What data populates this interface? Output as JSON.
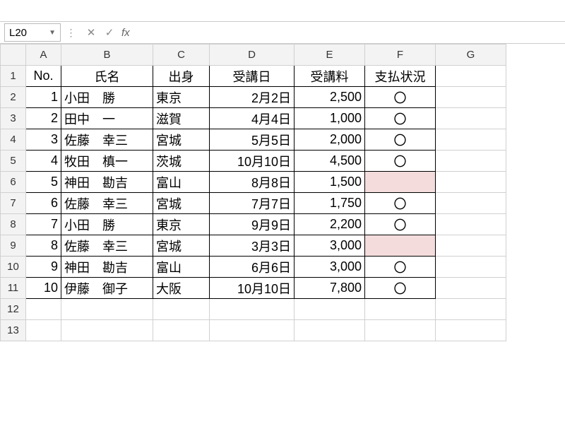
{
  "namebox": "L20",
  "fx_label": "fx",
  "formula_value": "",
  "columns": [
    "A",
    "B",
    "C",
    "D",
    "E",
    "F",
    "G"
  ],
  "rownums": [
    "1",
    "2",
    "3",
    "4",
    "5",
    "6",
    "7",
    "8",
    "9",
    "10",
    "11",
    "12",
    "13"
  ],
  "headers": {
    "A": "No.",
    "B": "氏名",
    "C": "出身",
    "D": "受講日",
    "E": "受講料",
    "F": "支払状況"
  },
  "rows": [
    {
      "no": "1",
      "name": "小田　勝",
      "origin": "東京",
      "date": "2月2日",
      "fee": "2,500",
      "status": "〇",
      "pink": false
    },
    {
      "no": "2",
      "name": "田中　一",
      "origin": "滋賀",
      "date": "4月4日",
      "fee": "1,000",
      "status": "〇",
      "pink": false
    },
    {
      "no": "3",
      "name": "佐藤　幸三",
      "origin": "宮城",
      "date": "5月5日",
      "fee": "2,000",
      "status": "〇",
      "pink": false
    },
    {
      "no": "4",
      "name": "牧田　槙一",
      "origin": "茨城",
      "date": "10月10日",
      "fee": "4,500",
      "status": "〇",
      "pink": false
    },
    {
      "no": "5",
      "name": "神田　勘吉",
      "origin": "富山",
      "date": "8月8日",
      "fee": "1,500",
      "status": "",
      "pink": true
    },
    {
      "no": "6",
      "name": "佐藤　幸三",
      "origin": "宮城",
      "date": "7月7日",
      "fee": "1,750",
      "status": "〇",
      "pink": false
    },
    {
      "no": "7",
      "name": "小田　勝",
      "origin": "東京",
      "date": "9月9日",
      "fee": "2,200",
      "status": "〇",
      "pink": false
    },
    {
      "no": "8",
      "name": "佐藤　幸三",
      "origin": "宮城",
      "date": "3月3日",
      "fee": "3,000",
      "status": "",
      "pink": true
    },
    {
      "no": "9",
      "name": "神田　勘吉",
      "origin": "富山",
      "date": "6月6日",
      "fee": "3,000",
      "status": "〇",
      "pink": false
    },
    {
      "no": "10",
      "name": "伊藤　御子",
      "origin": "大阪",
      "date": "10月10日",
      "fee": "7,800",
      "status": "〇",
      "pink": false
    }
  ]
}
